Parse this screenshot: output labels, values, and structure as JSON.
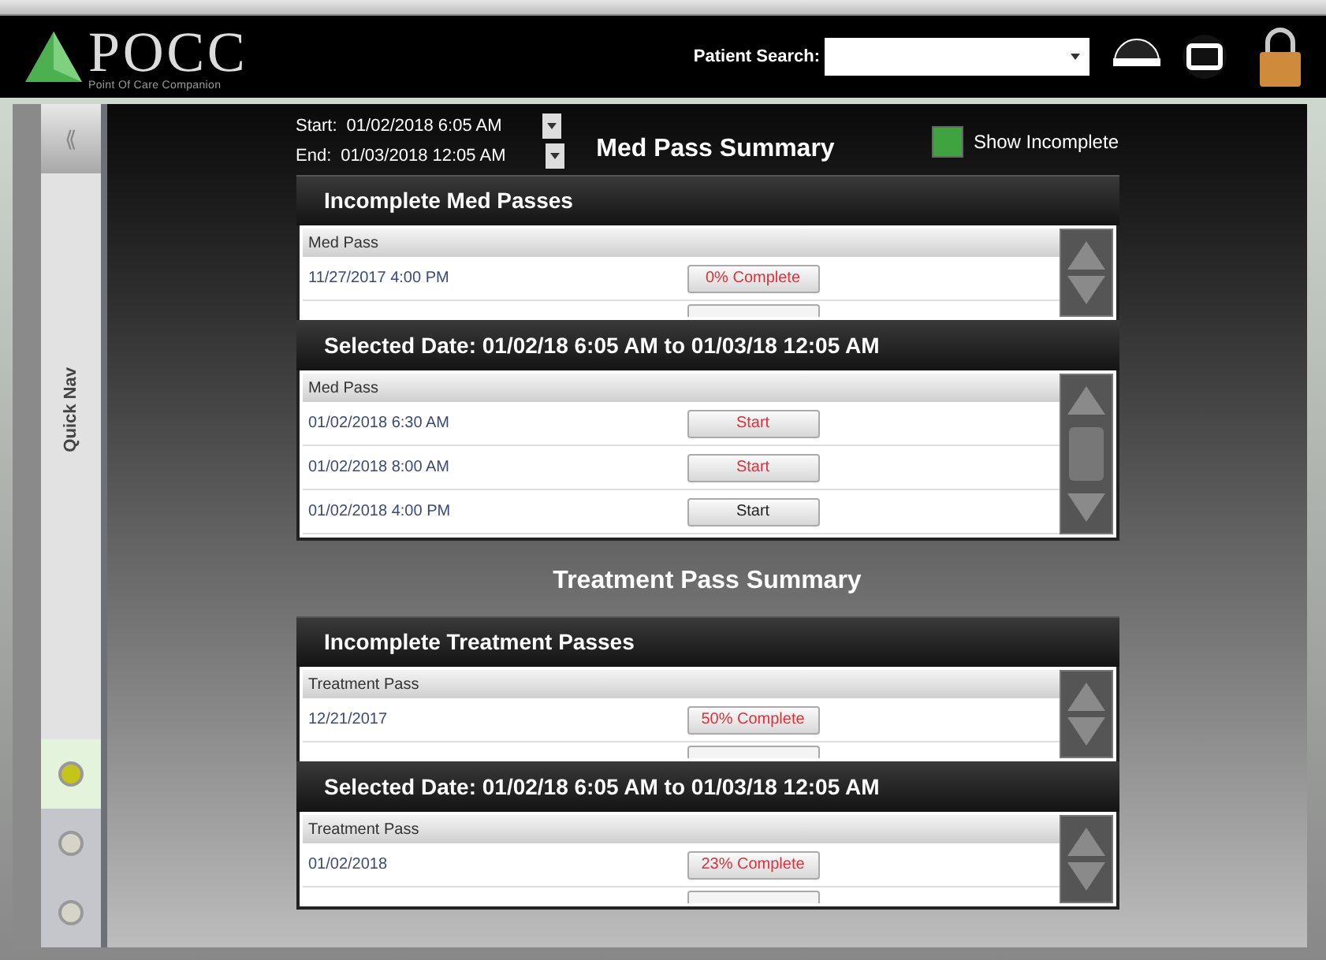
{
  "header": {
    "logo": "POCC",
    "logo_subtitle": "Point Of Care Companion",
    "patient_search_label": "Patient Search:"
  },
  "quick_nav": {
    "collapse": "⟪",
    "title": "Quick Nav",
    "dots": [
      {
        "selected": true
      },
      {
        "selected": false
      },
      {
        "selected": false
      }
    ]
  },
  "filters": {
    "start_label": "Start:",
    "start_value": "01/02/2018 6:05 AM",
    "end_label": "End:",
    "end_value": "01/03/2018 12:05 AM",
    "show_incomplete": {
      "label": "Show Incomplete",
      "checked": true
    }
  },
  "sections": [
    {
      "title": "Med Pass Summary",
      "panels": [
        {
          "title": "Incomplete Med Passes",
          "column": "Med Pass",
          "thumb": false,
          "rows": [
            {
              "date": "11/27/2017 4:00 PM",
              "action": "0% Complete",
              "alert": true
            }
          ],
          "partial_row": true
        },
        {
          "title": "Selected Date: 01/02/18 6:05 AM to 01/03/18 12:05 AM",
          "column": "Med Pass",
          "thumb": true,
          "rows": [
            {
              "date": "01/02/2018 6:30 AM",
              "action": "Start",
              "alert": true
            },
            {
              "date": "01/02/2018 8:00 AM",
              "action": "Start",
              "alert": true
            },
            {
              "date": "01/02/2018 4:00 PM",
              "action": "Start",
              "alert": false
            }
          ],
          "partial_row": false
        }
      ]
    },
    {
      "title": "Treatment Pass Summary",
      "panels": [
        {
          "title": "Incomplete Treatment Passes",
          "column": "Treatment Pass",
          "thumb": false,
          "rows": [
            {
              "date": "12/21/2017",
              "action": "50% Complete",
              "alert": true
            }
          ],
          "partial_row": true
        },
        {
          "title": "Selected Date: 01/02/18 6:05 AM to 01/03/18 12:05 AM",
          "column": "Treatment Pass",
          "thumb": false,
          "rows": [
            {
              "date": "01/02/2018",
              "action": "23% Complete",
              "alert": true
            }
          ],
          "partial_row": true
        }
      ]
    }
  ]
}
